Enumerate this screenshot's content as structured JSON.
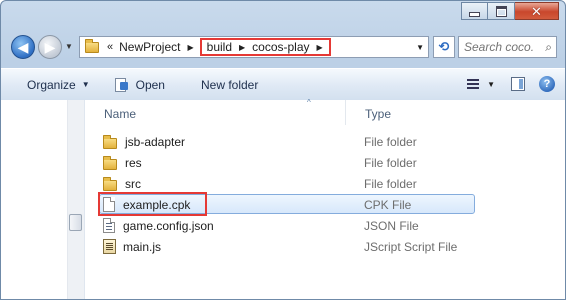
{
  "window": {
    "caption_buttons": {
      "minimize_icon": "minimize-icon",
      "maximize_icon": "maximize-icon",
      "close_icon": "close-icon",
      "close_glyph": "✕"
    }
  },
  "nav": {
    "back_glyph": "◀",
    "forward_glyph": "▶",
    "recent_dropdown_glyph": "▼"
  },
  "address": {
    "overflow": "«",
    "crumbs": [
      "NewProject",
      "build",
      "cocos-play"
    ],
    "sep": "▶",
    "dropdown_glyph": "▼",
    "refresh_glyph": "⟲"
  },
  "search": {
    "placeholder": "Search coco...",
    "icon": "search-icon",
    "glyph": "⌕"
  },
  "toolbar": {
    "organize_label": "Organize",
    "open_label": "Open",
    "new_folder_label": "New folder",
    "dropdown_glyph": "▼",
    "help_glyph": "?"
  },
  "columns": {
    "name": "Name",
    "type": "Type",
    "sort_glyph": "^"
  },
  "files": [
    {
      "name": "jsb-adapter",
      "type": "File folder",
      "icon": "folder-icon"
    },
    {
      "name": "res",
      "type": "File folder",
      "icon": "folder-icon"
    },
    {
      "name": "src",
      "type": "File folder",
      "icon": "folder-icon"
    },
    {
      "name": "example.cpk",
      "type": "CPK File",
      "icon": "file-icon",
      "selected": true
    },
    {
      "name": "game.config.json",
      "type": "JSON File",
      "icon": "file-icon"
    },
    {
      "name": "main.js",
      "type": "JScript Script File",
      "icon": "script-file-icon"
    }
  ],
  "colors": {
    "highlight_box": "#e53935",
    "selection": "#d7e8fb"
  }
}
